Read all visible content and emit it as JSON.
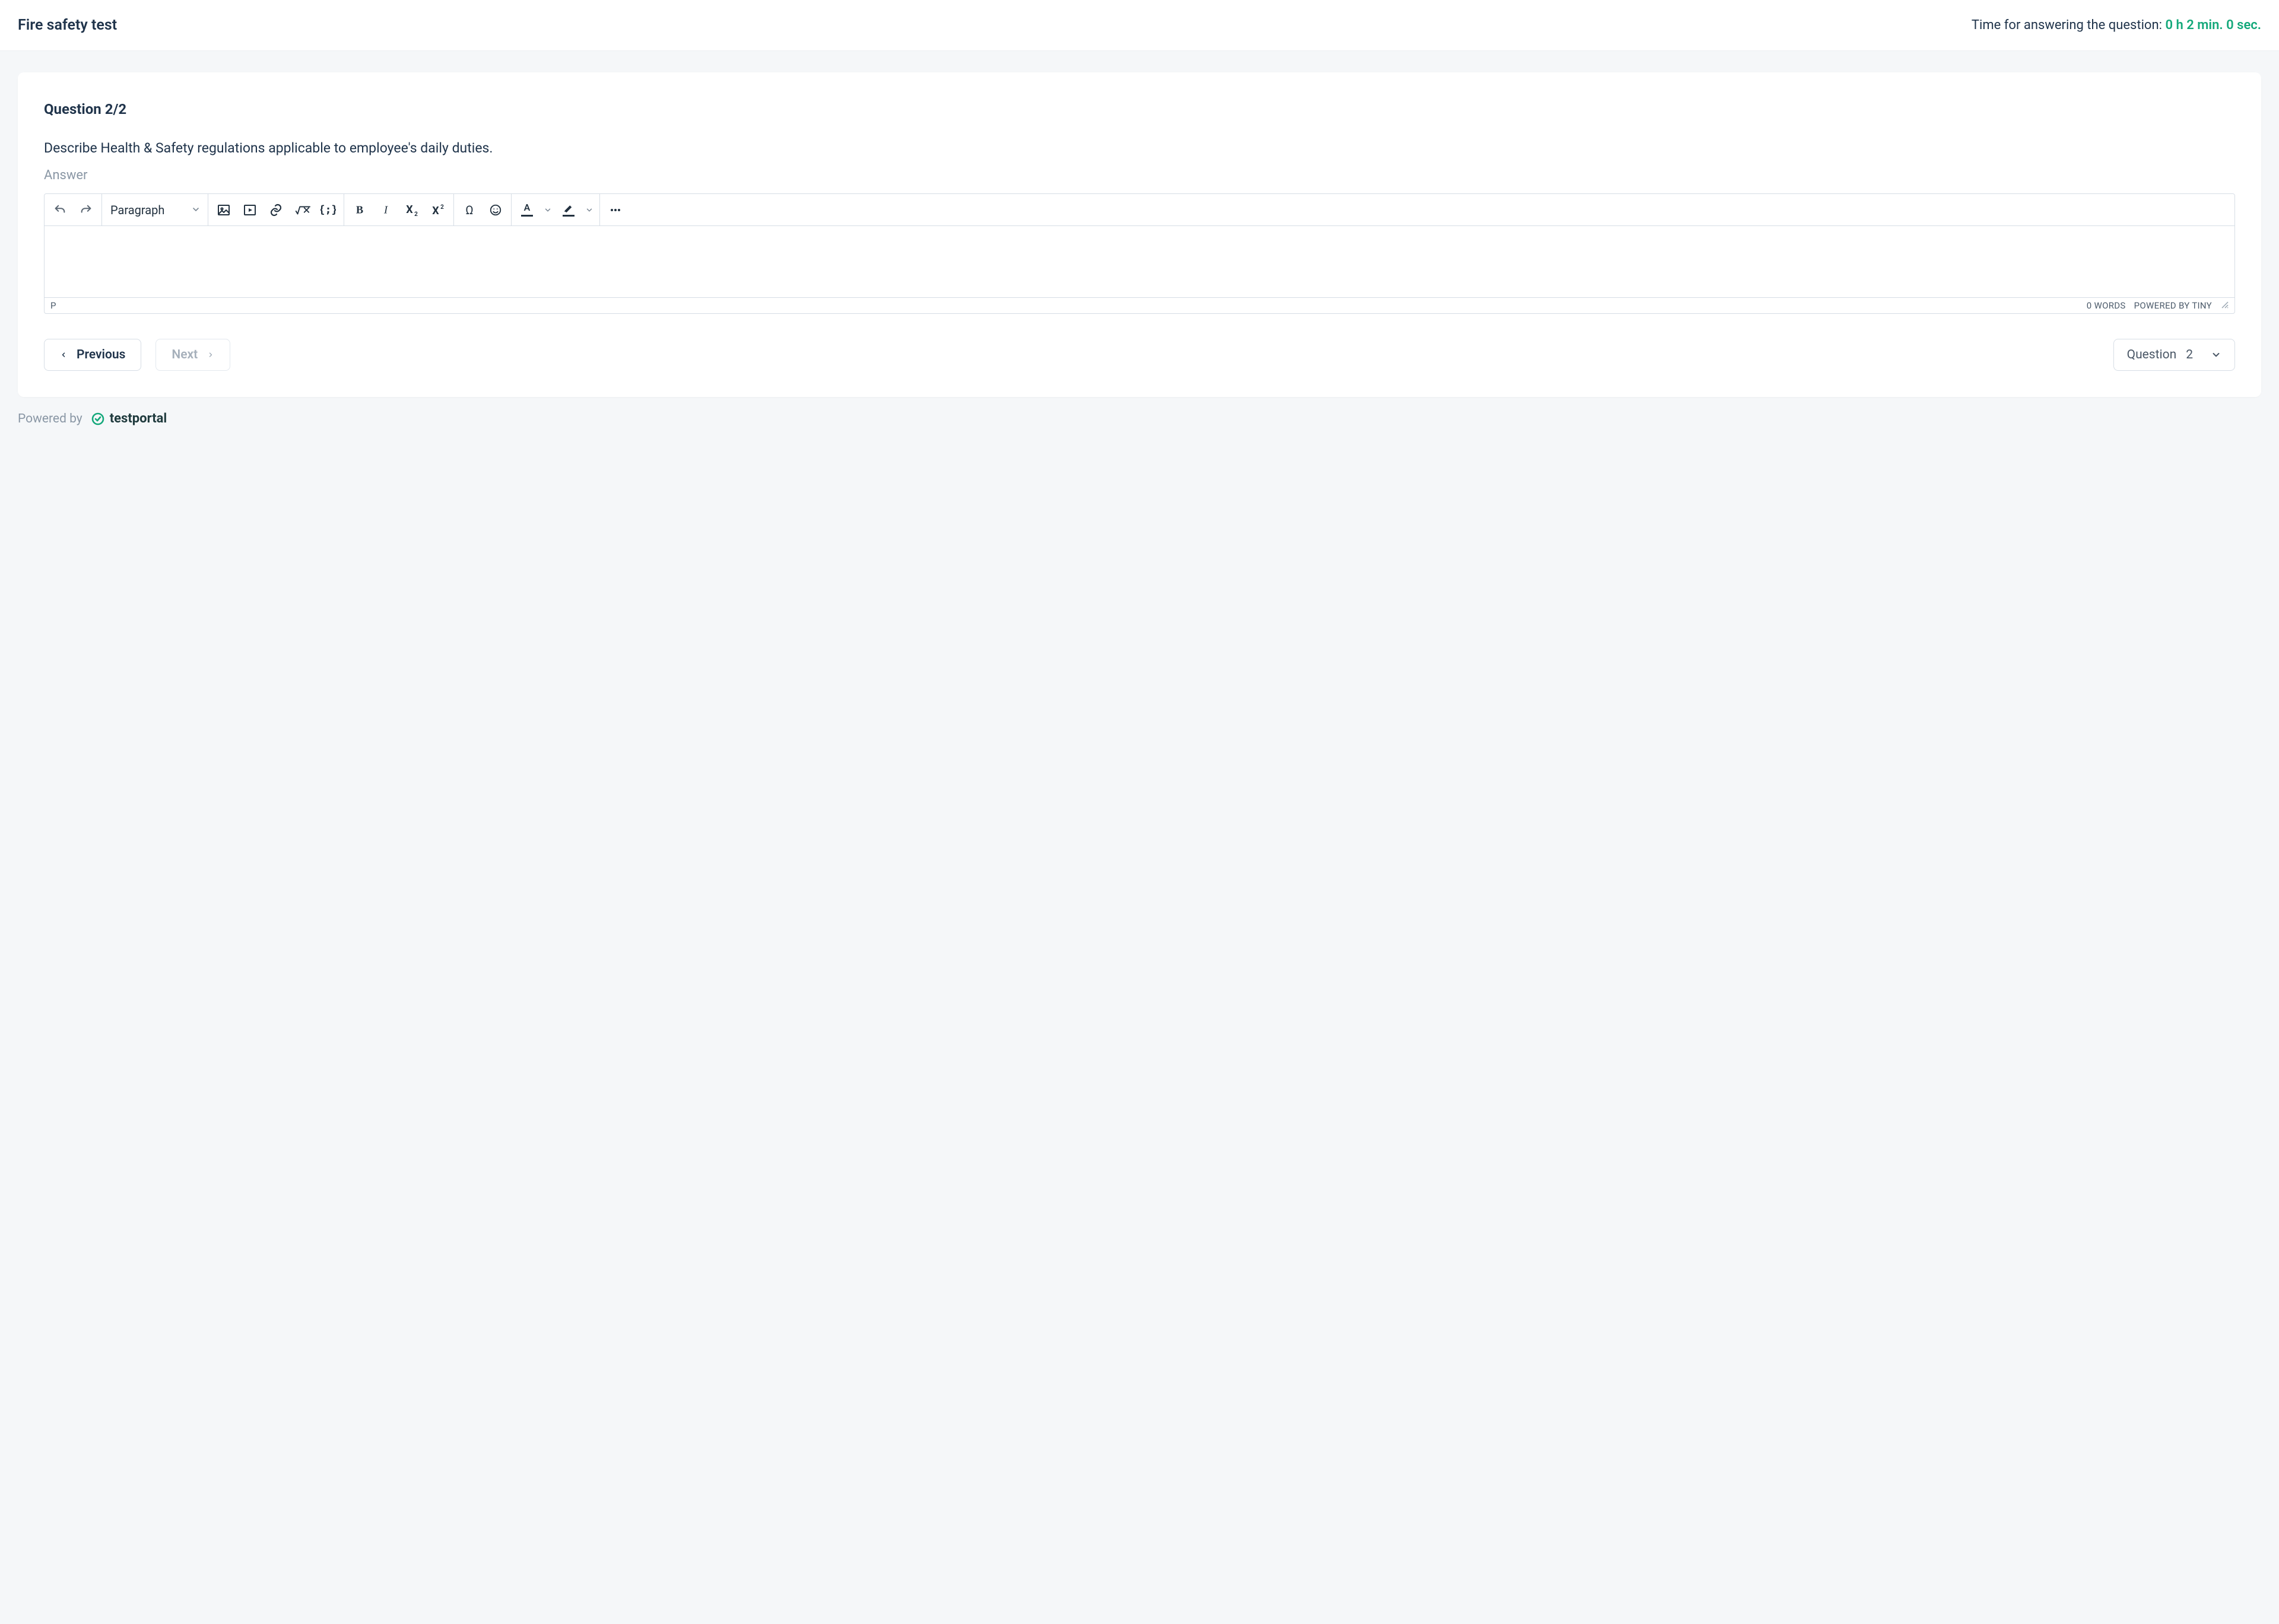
{
  "header": {
    "title": "Fire safety test",
    "timer_label": "Time for answering the question:",
    "timer_value": "0 h 2 min. 0 sec."
  },
  "question": {
    "indicator": "Question 2/2",
    "text": "Describe Health & Safety regulations applicable to employee's daily duties.",
    "answer_label": "Answer"
  },
  "editor": {
    "format_label": "Paragraph",
    "path": "P",
    "words": "0 WORDS",
    "powered": "POWERED BY TINY"
  },
  "nav": {
    "previous": "Previous",
    "next": "Next",
    "question_word": "Question",
    "question_current": "2"
  },
  "footer": {
    "powered_by": "Powered by",
    "brand": "testportal"
  }
}
